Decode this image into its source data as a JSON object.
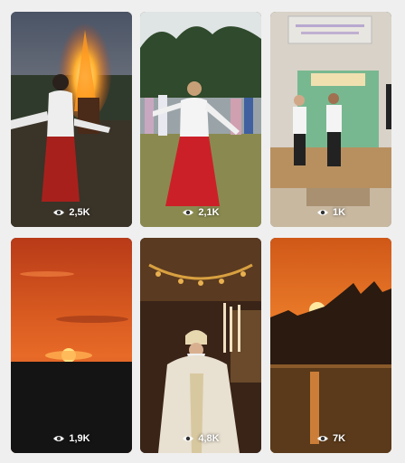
{
  "videos": [
    {
      "views": "2,5K",
      "thumb": "bonfire-dance-evening"
    },
    {
      "views": "2,1K",
      "thumb": "girl-dancing-red-skirt"
    },
    {
      "views": "1K",
      "thumb": "children-on-stage"
    },
    {
      "views": "1,9K",
      "thumb": "red-sunset-sky"
    },
    {
      "views": "4,8K",
      "thumb": "bishop-with-candles"
    },
    {
      "views": "7K",
      "thumb": "sunset-over-water"
    }
  ],
  "icon": "eye-icon",
  "colors": {
    "background": "#efefef",
    "overlay_text": "#ffffff"
  }
}
